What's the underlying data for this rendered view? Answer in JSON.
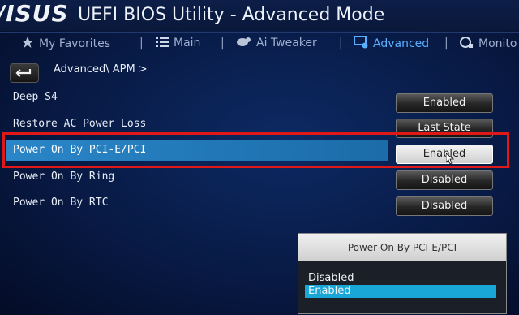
{
  "header": {
    "logo": "/ISUS",
    "title": "UEFI BIOS Utility - Advanced Mode"
  },
  "nav": {
    "items": [
      {
        "label": "My Favorites",
        "icon": "star-icon"
      },
      {
        "label": "Main",
        "icon": "list-icon"
      },
      {
        "label": "Ai Tweaker",
        "icon": "tweaker-icon"
      },
      {
        "label": "Advanced",
        "icon": "advanced-icon",
        "active": true
      },
      {
        "label": "Monito",
        "icon": "monitor-icon"
      }
    ]
  },
  "breadcrumb": "Advanced\\ APM >",
  "settings": [
    {
      "label": "Deep S4",
      "value": "Enabled"
    },
    {
      "label": "Restore AC Power Loss",
      "value": "Last State"
    },
    {
      "label": "Power On By PCI-E/PCI",
      "value": "Enabled",
      "selected": true
    },
    {
      "label": "Power On By Ring",
      "value": "Disabled"
    },
    {
      "label": "Power On By RTC",
      "value": "Disabled"
    }
  ],
  "popup": {
    "title": "Power On By PCI-E/PCI",
    "options": [
      "Disabled",
      "Enabled"
    ],
    "selected": "Enabled"
  },
  "colors": {
    "accent": "#5ab0ff",
    "highlight": "#2a86c8",
    "frame": "#e01818",
    "popup_select": "#18a7d6"
  }
}
